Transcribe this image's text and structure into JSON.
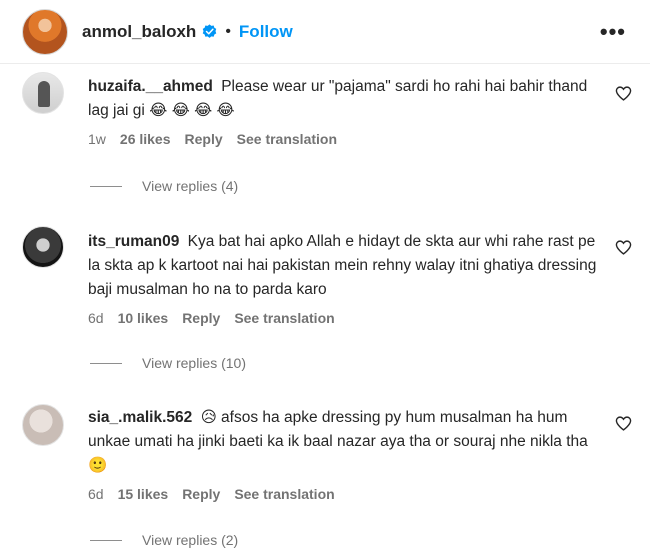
{
  "header": {
    "username": "anmol_baloxh",
    "separator": "•",
    "follow_label": "Follow",
    "more_label": "•••"
  },
  "comments": [
    {
      "username": "huzaifa.__ahmed",
      "text": "Please wear ur \"pajama\" sardi ho rahi hai bahir thand lag jai gi 😂 😂 😂 😂",
      "time": "1w",
      "likes": "26 likes",
      "reply_label": "Reply",
      "translate_label": "See translation",
      "view_replies": "View replies (4)"
    },
    {
      "username": "its_ruman09",
      "text": "Kya bat hai apko Allah e hidayt de skta aur whi rahe rast pe la skta ap k kartoot nai hai pakistan mein rehny walay itni ghatiya dressing baji musalman ho na to parda karo",
      "time": "6d",
      "likes": "10 likes",
      "reply_label": "Reply",
      "translate_label": "See translation",
      "view_replies": "View replies (10)"
    },
    {
      "username": "sia_.malik.562",
      "text": "😥 afsos ha apke dressing py hum musalman ha hum unkae umati ha jinki baeti ka ik baal nazar aya tha or souraj nhe nikla tha🙂",
      "time": "6d",
      "likes": "15 likes",
      "reply_label": "Reply",
      "translate_label": "See translation",
      "view_replies": "View replies (2)"
    }
  ],
  "colors": {
    "accent": "#0095f6",
    "text": "#262626",
    "secondary": "#737373"
  }
}
